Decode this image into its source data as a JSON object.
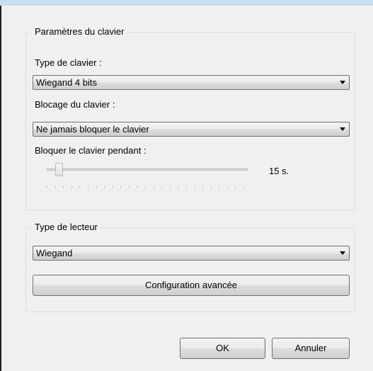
{
  "keyboard_settings": {
    "group_title": "Paramètres du clavier",
    "keyboard_type_label": "Type de clavier :",
    "keyboard_type_value": "Wiegand 4 bits",
    "lock_label": "Blocage du clavier :",
    "lock_value": "Ne jamais bloquer le clavier",
    "lock_duration_label": "Bloquer le clavier pendant :",
    "lock_duration_value": 15,
    "lock_duration_display": "15 s."
  },
  "reader_settings": {
    "group_title": "Type de lecteur",
    "reader_type_value": "Wiegand",
    "advanced_button": "Configuration avancée"
  },
  "footer": {
    "ok_label": "OK",
    "cancel_label": "Annuler"
  },
  "icons": {
    "dropdown": "chevron-down-icon"
  }
}
